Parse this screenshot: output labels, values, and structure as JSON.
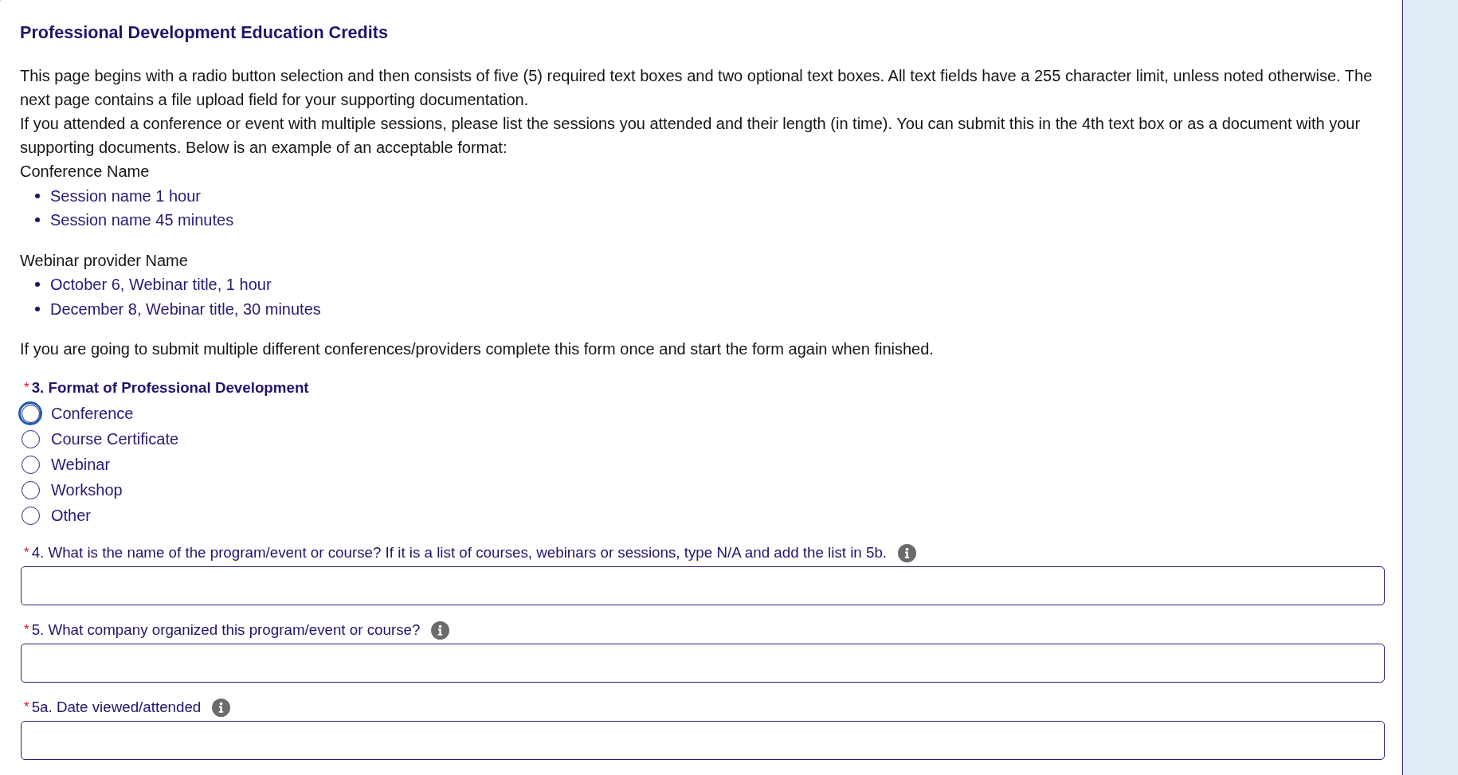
{
  "title": "Professional Development Education Credits",
  "intro": [
    "This page begins with a radio button selection and then consists of five (5) required text boxes and two optional text boxes. All text fields have a 255 character limit, unless noted otherwise. The next page contains a file upload field for your supporting documentation.",
    "If you attended a conference or event with multiple sessions, please list the sessions you attended and their length (in time). You can submit this in the 4th text box or as a document with your supporting documents. Below is an example of an acceptable format:"
  ],
  "examples": [
    {
      "heading": "Conference Name",
      "items": [
        "Session name 1 hour",
        "Session name 45 minutes"
      ]
    },
    {
      "heading": "Webinar provider Name",
      "items": [
        "October 6, Webinar title, 1 hour",
        "December 8, Webinar title, 30 minutes"
      ]
    }
  ],
  "note": "If you are going to submit multiple different conferences/providers complete this form once and start the form again when finished.",
  "questions": [
    {
      "kind": "radio",
      "required_mark": "*",
      "label": "3. Format of Professional Development",
      "options": [
        {
          "label": "Conference",
          "selected": false,
          "focused": true
        },
        {
          "label": "Course Certificate",
          "selected": false,
          "focused": false
        },
        {
          "label": "Webinar",
          "selected": false,
          "focused": false
        },
        {
          "label": "Workshop",
          "selected": false,
          "focused": false
        },
        {
          "label": "Other",
          "selected": false,
          "focused": false
        }
      ]
    },
    {
      "kind": "text",
      "required_mark": "*",
      "label": "4. What is the name of the program/event or course? If it is a list of courses, webinars or sessions, type N/A and add the list in 5b.",
      "info": true
    },
    {
      "kind": "text",
      "required_mark": "*",
      "label": "5. What company organized this program/event or course?",
      "info": true
    },
    {
      "kind": "text",
      "required_mark": "*",
      "label": "5a. Date viewed/attended",
      "info": true
    }
  ]
}
